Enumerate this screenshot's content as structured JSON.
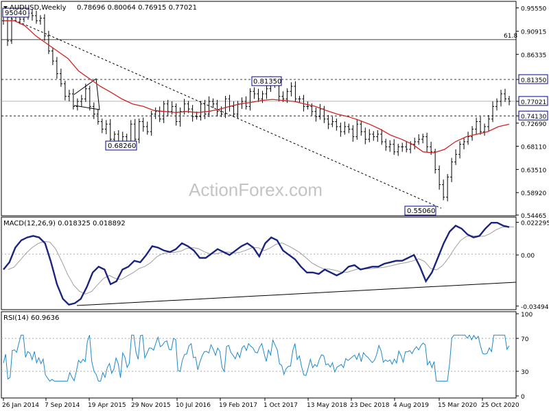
{
  "chart_data": [
    {
      "type": "candlestick",
      "title": "AUDUSD,Weekly",
      "ohlc_header": "0.78696 0.80064 0.76915 0.77021",
      "y_ticks": [
        "0.95550",
        "0.90915",
        "0.86335",
        "0.81350",
        "0.77021",
        "0.74130",
        "0.72690",
        "0.68110",
        "0.63510",
        "0.58920",
        "0.54465"
      ],
      "ylim": [
        0.5446,
        0.967
      ],
      "x_labels": [
        "26 Jan 2014",
        "7 Sep 2014",
        "19 Apr 2015",
        "29 Nov 2015",
        "10 Jul 2016",
        "19 Feb 2017",
        "1 Oct 2017",
        "13 May 2018",
        "23 Dec 2018",
        "4 Aug 2019",
        "15 Mar 2020",
        "25 Oct 2020"
      ],
      "annotations": [
        "95040",
        "0.81350",
        "0.68260",
        "0.55060"
      ],
      "fib_label": "61.8",
      "levels": [
        {
          "value": 0.8135,
          "label": "0.81350",
          "style": "dashed"
        },
        {
          "value": 0.7413,
          "label": "0.74130",
          "style": "dashed"
        },
        {
          "value": 0.7702,
          "label": "0.77021",
          "style": "solid"
        },
        {
          "value": 0.8925,
          "label": "61.8",
          "style": "solid"
        }
      ],
      "close_series": [
        0.93,
        0.89,
        0.94,
        0.945,
        0.933,
        0.94,
        0.945,
        0.94,
        0.93,
        0.935,
        0.9,
        0.87,
        0.85,
        0.825,
        0.805,
        0.78,
        0.785,
        0.76,
        0.77,
        0.775,
        0.795,
        0.76,
        0.745,
        0.73,
        0.715,
        0.725,
        0.695,
        0.705,
        0.685,
        0.7,
        0.69,
        0.725,
        0.695,
        0.73,
        0.72,
        0.71,
        0.745,
        0.75,
        0.735,
        0.765,
        0.75,
        0.76,
        0.73,
        0.75,
        0.765,
        0.755,
        0.74,
        0.74,
        0.765,
        0.745,
        0.77,
        0.765,
        0.75,
        0.745,
        0.775,
        0.76,
        0.745,
        0.765,
        0.77,
        0.76,
        0.79,
        0.785,
        0.775,
        0.785,
        0.795,
        0.81,
        0.805,
        0.78,
        0.775,
        0.79,
        0.8,
        0.775,
        0.775,
        0.76,
        0.76,
        0.75,
        0.74,
        0.755,
        0.735,
        0.725,
        0.73,
        0.72,
        0.71,
        0.72,
        0.715,
        0.7,
        0.725,
        0.71,
        0.695,
        0.705,
        0.7,
        0.705,
        0.69,
        0.68,
        0.685,
        0.67,
        0.68,
        0.68,
        0.675,
        0.685,
        0.69,
        0.695,
        0.7,
        0.68,
        0.67,
        0.635,
        0.605,
        0.58,
        0.62,
        0.65,
        0.665,
        0.685,
        0.69,
        0.7,
        0.715,
        0.73,
        0.71,
        0.72,
        0.735,
        0.76,
        0.77,
        0.785,
        0.775,
        0.7702
      ],
      "ma_series": [
        0.93,
        0.93,
        0.92,
        0.9,
        0.885,
        0.87,
        0.855,
        0.83,
        0.815,
        0.8,
        0.788,
        0.775,
        0.765,
        0.76,
        0.752,
        0.75,
        0.748,
        0.75,
        0.748,
        0.75,
        0.754,
        0.76,
        0.765,
        0.768,
        0.772,
        0.774,
        0.772,
        0.77,
        0.765,
        0.76,
        0.752,
        0.745,
        0.74,
        0.733,
        0.725,
        0.715,
        0.703,
        0.695,
        0.685,
        0.67,
        0.668,
        0.675,
        0.69,
        0.7,
        0.705,
        0.71,
        0.72,
        0.725
      ],
      "series_name_ma": ""
    },
    {
      "type": "line",
      "title": "MACD(12,26,9) 0.018325 0.018892",
      "y_ticks": [
        "0.022295",
        "0.00",
        "-0.034948"
      ],
      "ylim": [
        -0.0355,
        0.0235
      ],
      "macd": [
        -0.01,
        -0.005,
        0.005,
        0.01,
        0.012,
        0.013,
        0.012,
        0.008,
        -0.005,
        -0.02,
        -0.03,
        -0.034,
        -0.033,
        -0.03,
        -0.022,
        -0.012,
        -0.008,
        -0.01,
        -0.02,
        -0.018,
        -0.01,
        -0.008,
        -0.004,
        -0.005,
        0.0,
        0.006,
        0.005,
        0.003,
        0.002,
        0.004,
        0.008,
        0.006,
        0.003,
        -0.002,
        -0.002,
        0.001,
        0.004,
        0.002,
        0.0,
        0.003,
        0.006,
        0.008,
        0.005,
        -0.001,
        0.008,
        0.012,
        0.01,
        0.003,
        0.0,
        -0.003,
        -0.008,
        -0.012,
        -0.012,
        -0.013,
        -0.01,
        -0.012,
        -0.014,
        -0.012,
        -0.008,
        -0.007,
        -0.01,
        -0.009,
        -0.008,
        -0.008,
        -0.006,
        -0.005,
        -0.004,
        -0.004,
        -0.002,
        0.0,
        -0.008,
        -0.018,
        -0.012,
        -0.002,
        0.008,
        0.016,
        0.02,
        0.018,
        0.014,
        0.012,
        0.013,
        0.018,
        0.022,
        0.022,
        0.02,
        0.019
      ],
      "signal_series_name": "",
      "trendline_label": ""
    },
    {
      "type": "line",
      "title": "RSI(14) 60.9636",
      "y_ticks": [
        "100",
        "70",
        "30",
        "0"
      ],
      "ylim": [
        0,
        100
      ],
      "rsi_endpoints": [
        0,
        60.96
      ]
    }
  ],
  "watermark": "ActionForex.com",
  "colors": {
    "price": "#000000",
    "ma": "#d32020",
    "macd": "#1a237e",
    "signal": "#9e9e9e",
    "rsi": "#1e88c8",
    "level_box": "#00008b"
  }
}
